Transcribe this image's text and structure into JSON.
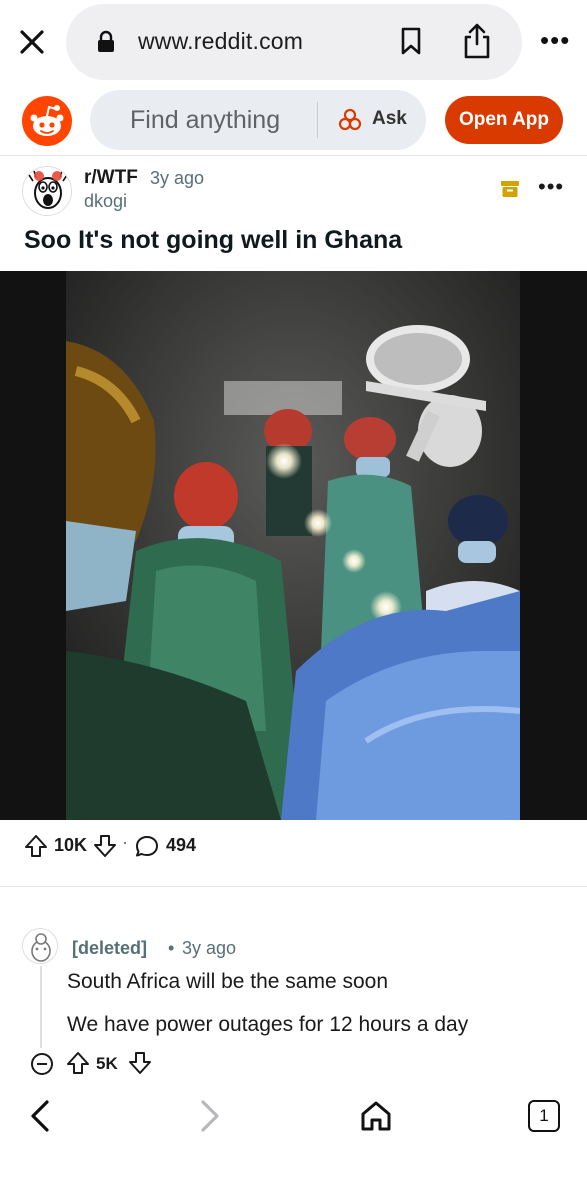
{
  "browser": {
    "url": "www.reddit.com",
    "tab_count": "1",
    "more_glyph": "•••"
  },
  "reddit_header": {
    "search_placeholder": "Find anything",
    "ask_label": "Ask",
    "open_app_label": "Open App",
    "brand_color": "#FF4500",
    "button_color": "#D93A00"
  },
  "post": {
    "subreddit": "r/WTF",
    "age": "3y ago",
    "author": "dkogi",
    "title": "Soo It's not going well in Ghana",
    "more_glyph": "•••",
    "score": "10K",
    "separator": "·",
    "comment_count": "494"
  },
  "comment": {
    "author": "[deleted]",
    "separator": "•",
    "age": "3y ago",
    "lines": [
      "South Africa will be the same soon",
      "We have power outages for 12 hours a day"
    ],
    "score": "5K"
  }
}
